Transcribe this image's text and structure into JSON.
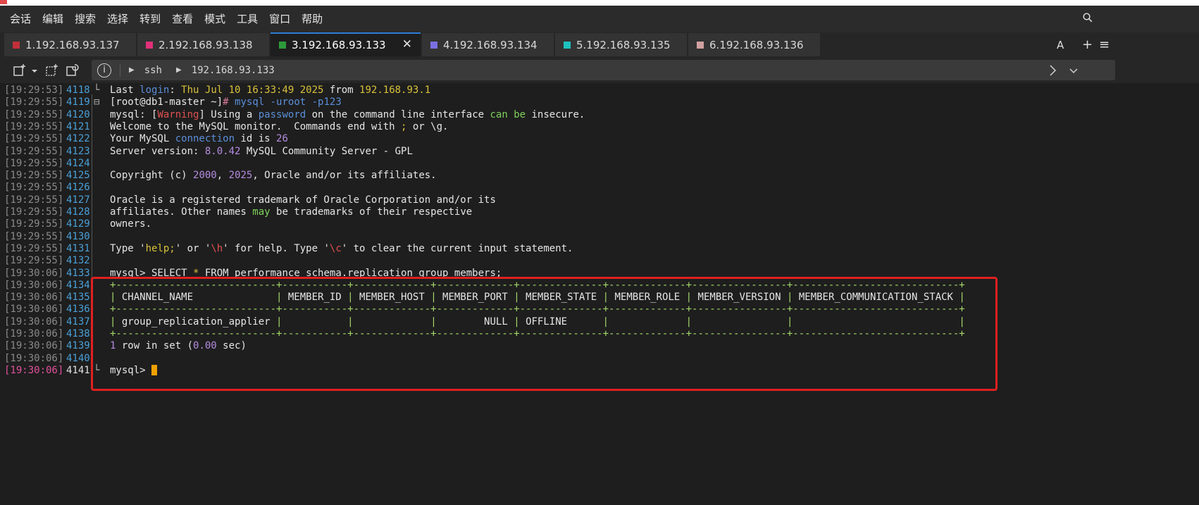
{
  "menu": [
    "会话",
    "编辑",
    "搜索",
    "选择",
    "转到",
    "查看",
    "模式",
    "工具",
    "窗口",
    "帮助"
  ],
  "tabs": [
    {
      "label": "1.192.168.93.137",
      "color": "#c0303a"
    },
    {
      "label": "2.192.168.93.138",
      "color": "#e0307a"
    },
    {
      "label": "3.192.168.93.133",
      "color": "#2e9a3a",
      "active": true
    },
    {
      "label": "4.192.168.93.134",
      "color": "#7a70e0"
    },
    {
      "label": "5.192.168.93.135",
      "color": "#20c0c0"
    },
    {
      "label": "6.192.168.93.136",
      "color": "#d0a0a0"
    }
  ],
  "tabbar_right": {
    "font": "A",
    "add": "+",
    "menu": "≡"
  },
  "address": {
    "protocol": "ssh",
    "host": "192.168.93.133"
  },
  "terminal": [
    {
      "ts": "[19:29:53]",
      "ln": "4118",
      "fold": "└",
      "html": "Last <span class='c-b'>login</span>: <span class='c-y'>Thu Jul 10 16:33:49 2025</span> from <span class='c-y'>192.168.93.1</span>"
    },
    {
      "ts": "[19:29:55]",
      "ln": "4119",
      "fold": "⊟",
      "html": "[root@db1-master ~]<span class='c-pk'>#</span> <span class='c-b'>mysql -uroot -p123</span>"
    },
    {
      "ts": "[19:29:55]",
      "ln": "4120",
      "html": "mysql: [<span class='c-r'>Warning</span>] Using a <span class='c-b'>password</span> on the command line interface <span class='c-g'>can be</span> insecure."
    },
    {
      "ts": "[19:29:55]",
      "ln": "4121",
      "html": "Welcome to the MySQL monitor.  Commands end with <span class='c-y'>;</span> or \\g."
    },
    {
      "ts": "[19:29:55]",
      "ln": "4122",
      "html": "Your MySQL <span class='c-b'>connection</span> id is <span class='c-p'>26</span>"
    },
    {
      "ts": "[19:29:55]",
      "ln": "4123",
      "html": "Server version: <span class='c-p'>8.0.42</span> MySQL Community Server - GPL"
    },
    {
      "ts": "[19:29:55]",
      "ln": "4124",
      "html": ""
    },
    {
      "ts": "[19:29:55]",
      "ln": "4125",
      "html": "Copyright (c) <span class='c-p'>2000</span>, <span class='c-p'>2025</span>, Oracle and/or its affiliates."
    },
    {
      "ts": "[19:29:55]",
      "ln": "4126",
      "html": ""
    },
    {
      "ts": "[19:29:55]",
      "ln": "4127",
      "html": "Oracle is a registered trademark of Oracle Corporation and/or its"
    },
    {
      "ts": "[19:29:55]",
      "ln": "4128",
      "html": "affiliates. Other names <span class='c-g'>may</span> be trademarks of their respective"
    },
    {
      "ts": "[19:29:55]",
      "ln": "4129",
      "html": "owners."
    },
    {
      "ts": "[19:29:55]",
      "ln": "4130",
      "html": ""
    },
    {
      "ts": "[19:29:55]",
      "ln": "4131",
      "html": "Type '<span class='c-y'>help;</span>' or '<span class='c-r'>\\h</span>' for help. Type '<span class='c-r'>\\c</span>' to clear the current input statement."
    },
    {
      "ts": "[19:29:55]",
      "ln": "4132",
      "html": ""
    },
    {
      "ts": "[19:30:06]",
      "ln": "4133",
      "html": "mysql&gt; SELECT <span class='c-y'>*</span> FROM performance_schema.replication_group_members;"
    },
    {
      "ts": "[19:30:06]",
      "ln": "4134",
      "html": "<span class='border-g'>+---------------------------+-----------+-------------+-------------+--------------+-------------+----------------+----------------------------+</span>"
    },
    {
      "ts": "[19:30:06]",
      "ln": "4135",
      "html": "<span class='border-g'>|</span> CHANNEL_NAME              <span class='border-g'>|</span> MEMBER_ID <span class='border-g'>|</span> MEMBER_HOST <span class='border-g'>|</span> MEMBER_PORT <span class='border-g'>|</span> MEMBER_STATE <span class='border-g'>|</span> MEMBER_ROLE <span class='border-g'>|</span> MEMBER_VERSION <span class='border-g'>|</span> MEMBER_COMMUNICATION_STACK <span class='border-g'>|</span>"
    },
    {
      "ts": "[19:30:06]",
      "ln": "4136",
      "html": "<span class='border-g'>+---------------------------+-----------+-------------+-------------+--------------+-------------+----------------+----------------------------+</span>"
    },
    {
      "ts": "[19:30:06]",
      "ln": "4137",
      "html": "<span class='border-g'>|</span> group_replication_applier <span class='border-g'>|</span>           <span class='border-g'>|</span>             <span class='border-g'>|</span>        NULL <span class='border-g'>|</span> OFFLINE      <span class='border-g'>|</span>             <span class='border-g'>|</span>                <span class='border-g'>|</span>                            <span class='border-g'>|</span>"
    },
    {
      "ts": "[19:30:06]",
      "ln": "4138",
      "html": "<span class='border-g'>+---------------------------+-----------+-------------+-------------+--------------+-------------+----------------+----------------------------+</span>"
    },
    {
      "ts": "[19:30:06]",
      "ln": "4139",
      "html": "<span class='c-p'>1</span> row in set (<span class='c-p'>0.00</span> sec)"
    },
    {
      "ts": "[19:30:06]",
      "ln": "4140",
      "html": ""
    },
    {
      "ts": "[19:30:06]",
      "ln": "4141",
      "fold": "└",
      "html": "mysql&gt; <span class='cursor'></span>",
      "current": true
    }
  ]
}
